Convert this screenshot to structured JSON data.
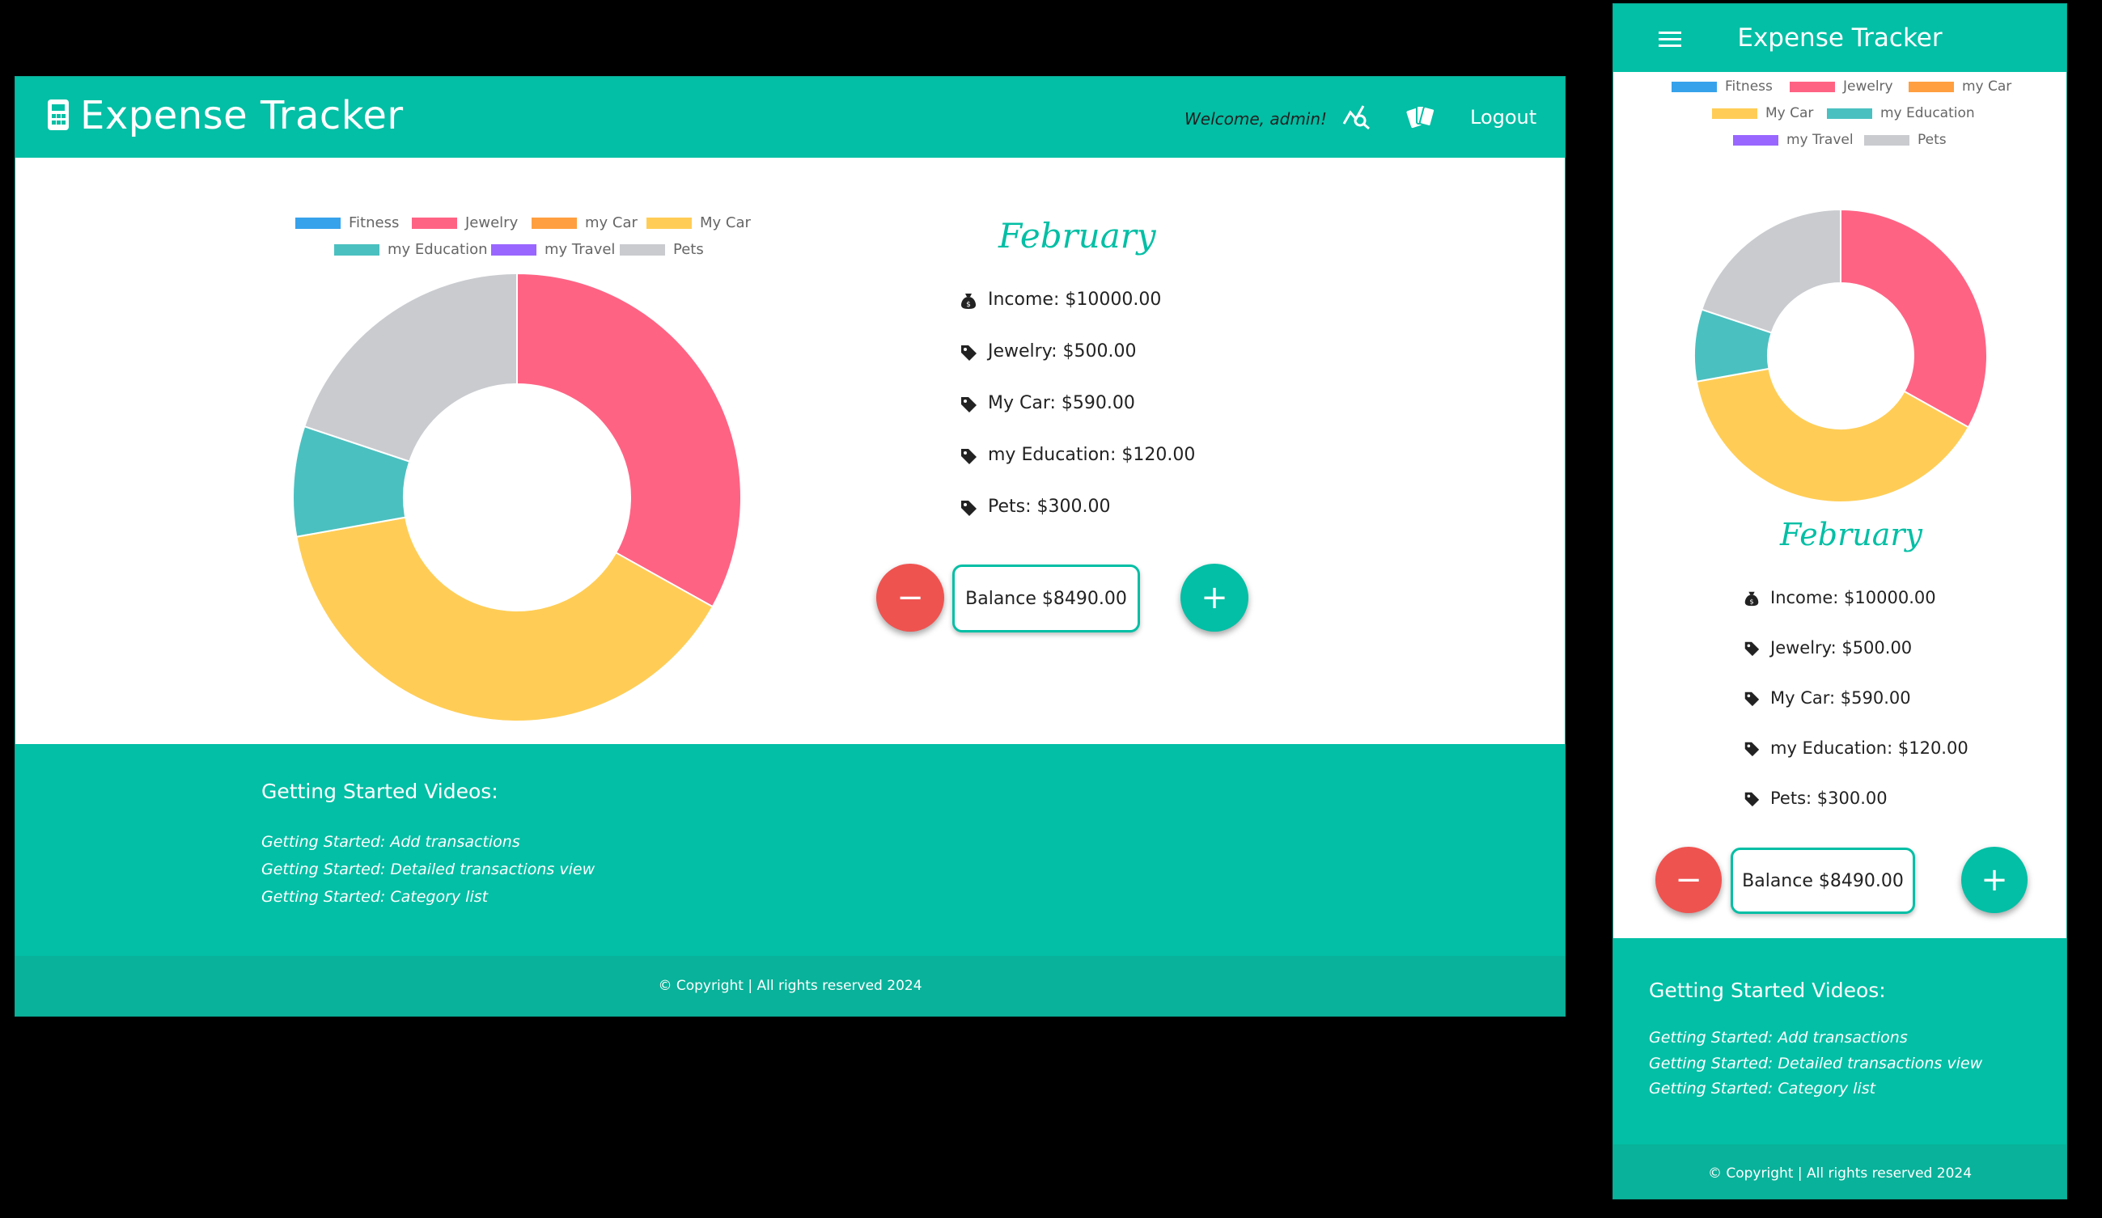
{
  "desktop": {
    "nav": {
      "brand": "Expense Tracker",
      "welcome": "Welcome, admin!",
      "logout": "Logout",
      "icons": [
        "calculator-icon",
        "chart-search-icon",
        "cards-icon"
      ]
    },
    "month": "February",
    "summary": [
      {
        "icon": "money-bag-icon",
        "text": "Income: $10000.00"
      },
      {
        "icon": "tag-icon",
        "text": "Jewelry: $500.00"
      },
      {
        "icon": "tag-icon",
        "text": "My Car: $590.00"
      },
      {
        "icon": "tag-icon",
        "text": "my Education: $120.00"
      },
      {
        "icon": "tag-icon",
        "text": "Pets: $300.00"
      }
    ],
    "balance": "Balance $8490.00",
    "minus_label": "−",
    "plus_label": "+",
    "footer": {
      "title": "Getting Started Videos:",
      "links": [
        "Getting Started: Add transactions",
        "Getting Started: Detailed transactions view",
        "Getting Started: Category list"
      ],
      "copyright": "© Copyright | All rights reserved 2024"
    }
  },
  "mobile": {
    "nav": {
      "brand": "Expense Tracker",
      "icons": [
        "menu-icon"
      ]
    },
    "month": "February",
    "summary": [
      {
        "icon": "money-bag-icon",
        "text": "Income: $10000.00"
      },
      {
        "icon": "tag-icon",
        "text": "Jewelry: $500.00"
      },
      {
        "icon": "tag-icon",
        "text": "My Car: $590.00"
      },
      {
        "icon": "tag-icon",
        "text": "my Education: $120.00"
      },
      {
        "icon": "tag-icon",
        "text": "Pets: $300.00"
      }
    ],
    "balance": "Balance $8490.00",
    "minus_label": "−",
    "plus_label": "+",
    "footer": {
      "title": "Getting Started Videos:",
      "links": [
        "Getting Started: Add transactions",
        "Getting Started: Detailed transactions view",
        "Getting Started: Category list"
      ],
      "copyright": "© Copyright | All rights reserved 2024"
    }
  },
  "chart_data": {
    "type": "pie",
    "variant": "doughnut",
    "categories": [
      "Fitness",
      "Jewelry",
      "my Car",
      "My Car",
      "my Education",
      "my Travel",
      "Pets"
    ],
    "values": [
      0,
      500,
      0,
      590,
      120,
      0,
      300
    ],
    "colors": [
      "#36a2eb",
      "#ff6384",
      "#ff9f40",
      "#ffcd56",
      "#4bc0c0",
      "#9966ff",
      "#c9cbcf"
    ],
    "legend": "top"
  },
  "colors": {
    "primary": "#02bfa5",
    "footer_dark": "#09b29a",
    "minus": "#ef5350",
    "background": "#000000"
  }
}
